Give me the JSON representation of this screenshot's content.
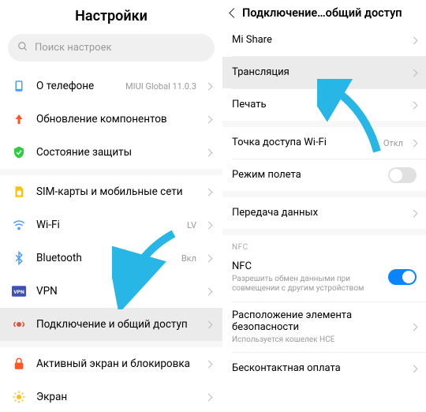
{
  "colors": {
    "accent": "#0a84ff",
    "arrow": "#27b6e6"
  },
  "left": {
    "title": "Настройки",
    "search_placeholder": "Поиск настроек",
    "items": [
      {
        "key": "about",
        "label": "О телефоне",
        "value": "MIUI Global 11.0.3"
      },
      {
        "key": "update",
        "label": "Обновление компонентов"
      },
      {
        "key": "security",
        "label": "Состояние защиты"
      },
      {
        "key": "sim",
        "label": "SIM-карты и мобильные сети"
      },
      {
        "key": "wifi",
        "label": "Wi-Fi",
        "value": "LV"
      },
      {
        "key": "bluetooth",
        "label": "Bluetooth",
        "value": "Вкл"
      },
      {
        "key": "vpn",
        "label": "VPN"
      },
      {
        "key": "connection",
        "label": "Подключение и общий доступ"
      },
      {
        "key": "display-lock",
        "label": "Активный экран и блокировка"
      },
      {
        "key": "screen",
        "label": "Экран"
      }
    ]
  },
  "right": {
    "title": "Подключение…общий доступ",
    "items": [
      {
        "key": "mishare",
        "label": "Mi Share"
      },
      {
        "key": "cast",
        "label": "Трансляция"
      },
      {
        "key": "print",
        "label": "Печать"
      },
      {
        "key": "hotspot",
        "label": "Точка доступа Wi-Fi",
        "value": "Откл"
      },
      {
        "key": "airplane",
        "label": "Режим полета",
        "toggle": false
      },
      {
        "key": "data",
        "label": "Передача данных"
      }
    ],
    "nfc_section": "NFC",
    "nfc": {
      "label": "NFC",
      "sub": "Разрешить обмен данными при совмещении с другим устройством",
      "toggle": true
    },
    "secure": {
      "label": "Расположение элемента безопасности",
      "sub": "Используется кошелек HCE"
    },
    "contactless": {
      "label": "Бесконтактная оплата"
    }
  }
}
